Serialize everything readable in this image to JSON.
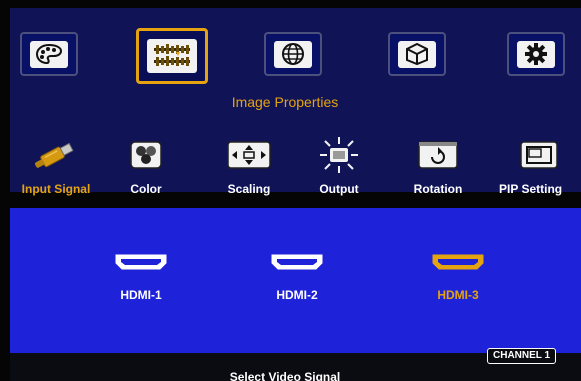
{
  "categories": {
    "active_label": "Image Properties",
    "items": [
      {
        "icon": "palette-icon"
      },
      {
        "icon": "image-properties-icon",
        "active": true
      },
      {
        "icon": "globe-icon"
      },
      {
        "icon": "3d-cube-icon"
      },
      {
        "icon": "gear-icon"
      }
    ]
  },
  "tabs": [
    {
      "label": "Input Signal",
      "icon": "hdmi-cable-icon",
      "active": true
    },
    {
      "label": "Color",
      "icon": "color-rgb-icon"
    },
    {
      "label": "Scaling",
      "icon": "scaling-arrows-icon"
    },
    {
      "label": "Output",
      "icon": "output-burst-icon"
    },
    {
      "label": "Rotation",
      "icon": "rotation-icon"
    },
    {
      "label": "PIP Setting",
      "icon": "pip-window-icon"
    }
  ],
  "inputs": [
    {
      "label": "HDMI-1",
      "icon": "hdmi-port-icon"
    },
    {
      "label": "HDMI-2",
      "icon": "hdmi-port-icon"
    },
    {
      "label": "HDMI-3",
      "icon": "hdmi-port-icon",
      "selected": true
    }
  ],
  "status": {
    "message": "Select Video Signal",
    "channel": "CHANNEL 1"
  },
  "colors": {
    "top_panel": "#101457",
    "sub_panel": "#1e22d9",
    "accent": "#e5a40f",
    "text": "#ffffff"
  }
}
